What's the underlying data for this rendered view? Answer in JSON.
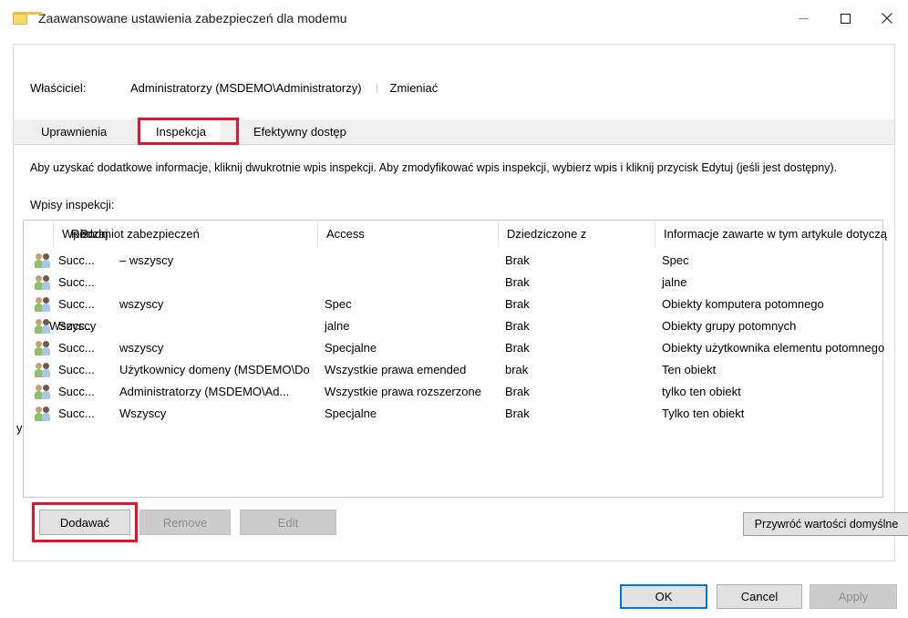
{
  "window": {
    "title": "Zaawansowane ustawienia zabezpieczeń dla modemu",
    "icon": "folder-icon",
    "controls": {
      "minimize": "minimize-icon",
      "maximize": "maximize-icon",
      "close": "close-icon"
    }
  },
  "owner": {
    "label": "Właściciel:",
    "value": "Administratorzy (MSDEMO\\Administratorzy)",
    "change_link": "Zmieniać"
  },
  "tabs": [
    {
      "label": "Uprawnienia",
      "active": false
    },
    {
      "label": "Inspekcja",
      "active": true,
      "highlighted": true
    },
    {
      "label": "Efektywny dostęp",
      "active": false
    }
  ],
  "panel": {
    "hint": "Aby uzyskać dodatkowe informacje, kliknij dwukrotnie wpis inspekcji. Aby zmodyfikować wpis inspekcji, wybierz wpis i kliknij przycisk Edytuj (jeśli jest dostępny).",
    "entries_label": "Wpisy inspekcji:"
  },
  "table": {
    "headers": {
      "type_a": "Wpis",
      "type_b": "Rodzaj",
      "principal": "Podmiot zabezpieczeń",
      "access": "Access",
      "inherited": "Dziedziczone z",
      "applies": "Informacje zawarte w tym artykule dotyczą"
    },
    "rows": [
      {
        "icon": "users-group-icon",
        "type": "Succ...",
        "principal": "– wszyscy",
        "access": "",
        "inherited": "Brak",
        "applies": "Spec"
      },
      {
        "icon": "users-group-icon",
        "type": "Succ...",
        "principal": "",
        "access": "",
        "inherited": "Brak",
        "applies": "jalne"
      },
      {
        "icon": "users-group-icon",
        "type": "Succ...",
        "principal": "wszyscy",
        "access": "Spec",
        "inherited": "Brak",
        "applies": "Obiekty komputera potomnego"
      },
      {
        "icon": "users-group-icon",
        "type": "Succ...",
        "type_overlay": "Wszyscy",
        "principal": "",
        "access": "jalne",
        "inherited": "Brak",
        "applies": "Obiekty grupy potomnych"
      },
      {
        "icon": "users-group-icon",
        "type": "Succ...",
        "principal": "wszyscy",
        "access": "Specjalne",
        "inherited": "Brak",
        "applies": "Obiekty użytkownika elementu potomnego"
      },
      {
        "icon": "users-group-icon",
        "type": "Succ...",
        "principal": "Użytkownicy domeny (MSDEMO\\Do",
        "access": "Wszystkie prawa emended",
        "inherited": "brak",
        "applies": "Ten obiekt"
      },
      {
        "icon": "users-group-icon",
        "type": "Succ...",
        "principal": "Administratorzy (MSDEMO\\Ad...",
        "access": "Wszystkie prawa rozszerzone",
        "inherited": "Brak",
        "applies": "tylko ten obiekt"
      },
      {
        "icon": "users-group-icon",
        "type": "Succ...",
        "principal": "Wszyscy",
        "access": "Specjalne",
        "inherited": "Brak",
        "applies": "Tylko ten obiekt"
      }
    ],
    "stray_left_glyph": "y"
  },
  "actions": {
    "add": {
      "label": "Dodawać",
      "enabled": true,
      "highlighted": true
    },
    "remove": {
      "label": "Remove",
      "enabled": false
    },
    "edit": {
      "label": "Edit",
      "enabled": false
    },
    "restore_defaults": {
      "label": "Przywróć wartości domyślne",
      "enabled": true
    }
  },
  "footer": {
    "ok": {
      "label": "OK",
      "enabled": true,
      "default": true
    },
    "cancel": {
      "label": "Cancel",
      "enabled": true
    },
    "apply": {
      "label": "Apply",
      "enabled": false
    }
  },
  "colors": {
    "accent": "#0078d7",
    "highlight": "#e8112d",
    "card_border": "#d9d9d9",
    "tab_strip": "#f0f0f0"
  }
}
